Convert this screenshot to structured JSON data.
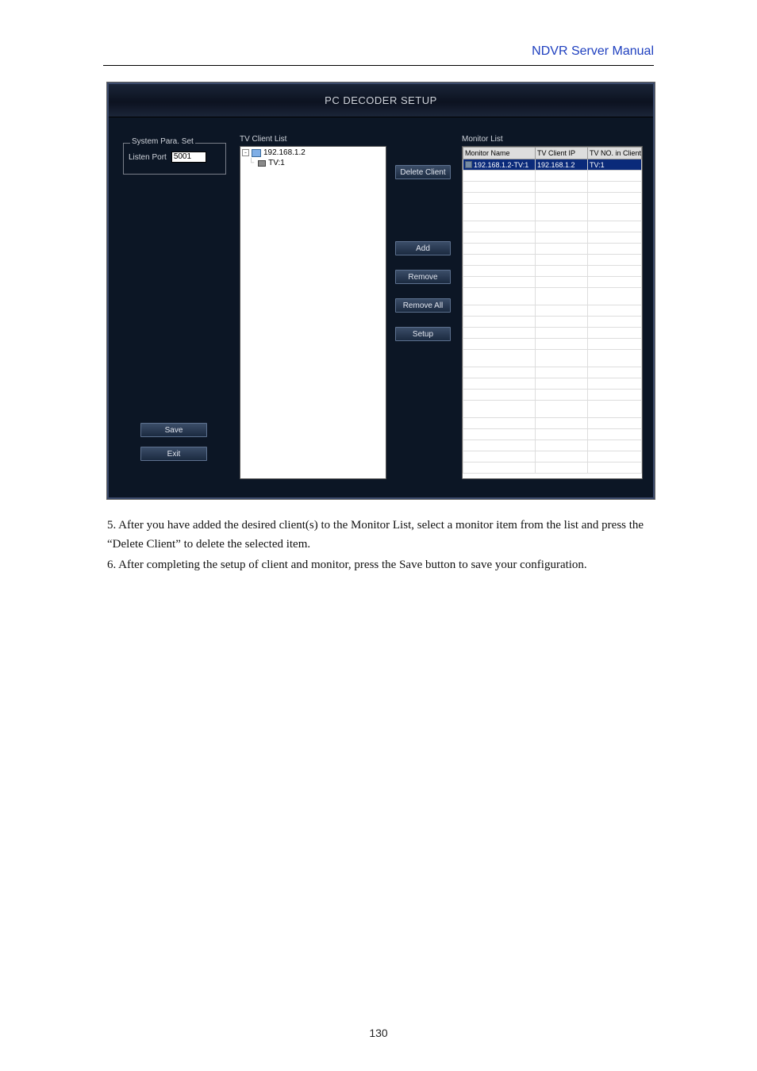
{
  "header": {
    "title": "NDVR Server Manual"
  },
  "footer": {
    "page_number": "130"
  },
  "window": {
    "title": "PC DECODER SETUP",
    "system_para": {
      "legend": "System Para. Set",
      "listen_port_label": "Listen Port",
      "listen_port_value": "5001"
    },
    "tv_client_list": {
      "label": "TV Client List",
      "root": "192.168.1.2",
      "child": "TV:1"
    },
    "buttons": {
      "delete_client": "Delete Client",
      "add": "Add",
      "remove": "Remove",
      "remove_all": "Remove All",
      "setup": "Setup",
      "save": "Save",
      "exit": "Exit"
    },
    "monitor_list": {
      "label": "Monitor List",
      "col1": "Monitor Name",
      "col2": "TV Client IP",
      "col3": "TV NO. in Client",
      "row": {
        "name": "192.168.1.2-TV:1",
        "ip": "192.168.1.2",
        "tvno": "TV:1"
      }
    }
  },
  "text": {
    "p1": "5. After you have added the desired client(s) to the Monitor List, select a monitor item from the list and press the “Delete Client” to delete the selected item.",
    "p2": "6. After completing the setup of client and monitor, press the Save button to save your configuration."
  }
}
